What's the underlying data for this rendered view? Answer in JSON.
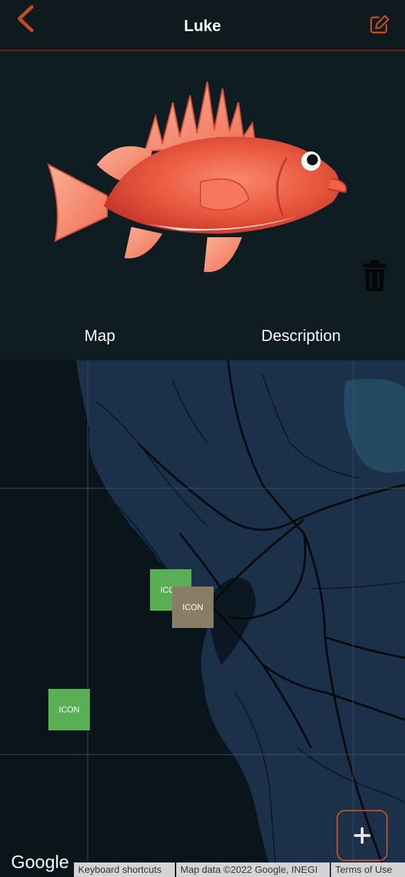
{
  "header": {
    "title": "Luke",
    "accent_color": "#c44a2c",
    "back_icon": "chevron-left-icon",
    "edit_icon": "edit-icon"
  },
  "hero": {
    "image": "red-fish-illustration",
    "trash_icon": "trash-icon"
  },
  "tabs": [
    "Map",
    "Description"
  ],
  "map": {
    "markers": [
      {
        "label": "ICON",
        "color": "#5aaf56"
      },
      {
        "label": "ICON",
        "color": "#8b7d65"
      },
      {
        "label": "ICON",
        "color": "#5aaf56"
      }
    ],
    "add_icon": "plus-icon",
    "google_label": "Google",
    "attribution": [
      "Keyboard shortcuts",
      "Map data ©2022 Google, INEGI",
      "Terms of Use"
    ]
  }
}
